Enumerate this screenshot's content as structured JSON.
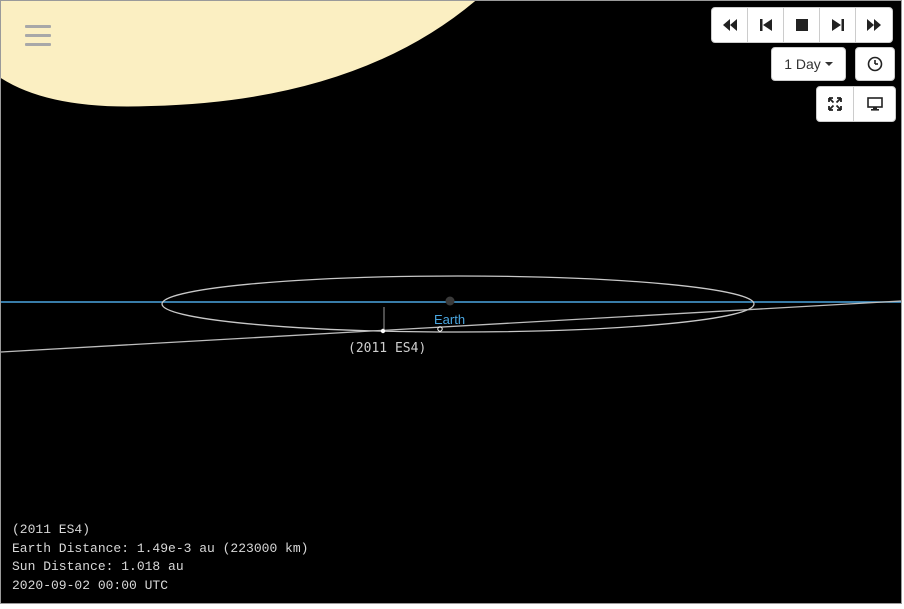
{
  "labels": {
    "earth": "Earth",
    "object": "(2011 ES4)"
  },
  "toolbar": {
    "step_label": "1 Day",
    "buttons": [
      "fast-rewind-icon",
      "step-back-icon",
      "stop-icon",
      "step-forward-icon",
      "fast-forward-icon"
    ]
  },
  "info": {
    "name": "(2011 ES4)",
    "earth_distance": "Earth Distance: 1.49e-3 au (223000 km)",
    "sun_distance": "Sun Distance: 1.018 au",
    "datetime": "2020-09-02 00:00 UTC"
  },
  "colors": {
    "sun": "#fbefc2",
    "earth_orbit": "#4aa6e0",
    "object_orbit": "#c8c8c8",
    "background": "#000000"
  }
}
